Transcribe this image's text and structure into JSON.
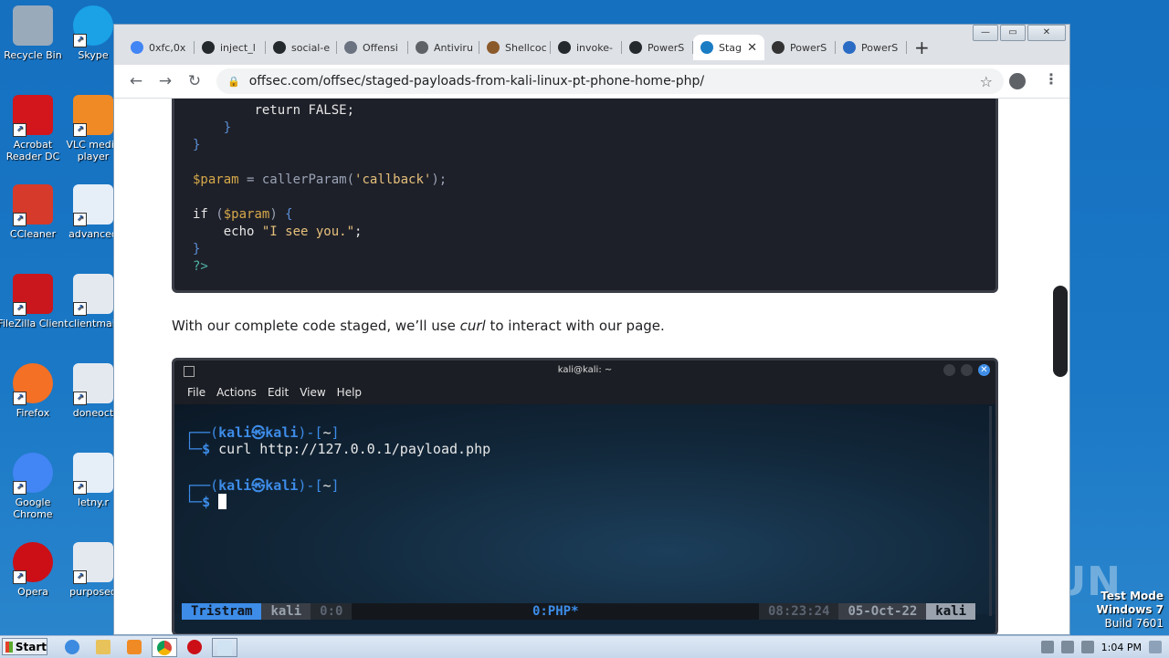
{
  "desktop": {
    "icons": [
      {
        "label": "Recycle Bin",
        "icon": "recycle-bin-icon"
      },
      {
        "label": "Skype",
        "icon": "skype-icon"
      },
      {
        "label": "Acrobat Reader DC",
        "icon": "acrobat-icon"
      },
      {
        "label": "VLC media player",
        "icon": "vlc-icon"
      },
      {
        "label": "CCleaner",
        "icon": "ccleaner-icon"
      },
      {
        "label": "advanced",
        "icon": "word-doc-icon"
      },
      {
        "label": "FileZilla Client",
        "icon": "filezilla-icon"
      },
      {
        "label": "clientmail",
        "icon": "file-icon"
      },
      {
        "label": "Firefox",
        "icon": "firefox-icon"
      },
      {
        "label": "doneoct",
        "icon": "file-icon"
      },
      {
        "label": "Google Chrome",
        "icon": "chrome-icon"
      },
      {
        "label": "letny.r",
        "icon": "word-doc-icon"
      },
      {
        "label": "Opera",
        "icon": "opera-icon"
      },
      {
        "label": "purposed",
        "icon": "file-icon"
      }
    ],
    "watermark": "ANY.RUN",
    "test_mode": {
      "line1": "Test Mode",
      "line2": "Windows 7",
      "line3": "Build 7601"
    }
  },
  "taskbar": {
    "start_label": "Start",
    "clock": "1:04 PM"
  },
  "browser": {
    "tabs": [
      {
        "label": "0xfc,0x",
        "icon": "google-icon",
        "color": "#4285f4"
      },
      {
        "label": "inject_l",
        "icon": "github-icon",
        "color": "#24292e"
      },
      {
        "label": "social-e",
        "icon": "github-icon",
        "color": "#24292e"
      },
      {
        "label": "Offensi",
        "icon": "offensive-icon",
        "color": "#6b7280"
      },
      {
        "label": "Antiviru",
        "icon": "globe-icon",
        "color": "#5f6368"
      },
      {
        "label": "Shellcoc",
        "icon": "shellcode-icon",
        "color": "#8b5a2b"
      },
      {
        "label": "invoke-",
        "icon": "github-icon",
        "color": "#24292e"
      },
      {
        "label": "PowerS",
        "icon": "github-icon",
        "color": "#24292e"
      },
      {
        "label": "Stag",
        "icon": "offsec-icon",
        "color": "#1a7dc4",
        "active": true
      },
      {
        "label": "PowerS",
        "icon": "pt-icon",
        "color": "#333333"
      },
      {
        "label": "PowerS",
        "icon": "powershell-icon",
        "color": "#2a6cc4"
      }
    ],
    "url": "offsec.com/offsec/staged-payloads-from-kali-linux-pt-phone-home-php/"
  },
  "article": {
    "code_lines": [
      {
        "indent": "        ",
        "parts": [
          {
            "t": "return FALSE;",
            "c": "kw"
          }
        ]
      },
      {
        "indent": "    ",
        "parts": [
          {
            "t": "}",
            "c": "br"
          }
        ]
      },
      {
        "indent": "",
        "parts": [
          {
            "t": "}",
            "c": "br"
          }
        ]
      },
      {
        "indent": "",
        "parts": []
      },
      {
        "indent": "",
        "parts": [
          {
            "t": "$param",
            "c": "var"
          },
          {
            "t": " = ",
            "c": "fn"
          },
          {
            "t": "callerParam(",
            "c": "fn"
          },
          {
            "t": "'callback'",
            "c": "str"
          },
          {
            "t": ");",
            "c": "fn"
          }
        ]
      },
      {
        "indent": "",
        "parts": []
      },
      {
        "indent": "",
        "parts": [
          {
            "t": "if ",
            "c": "kw"
          },
          {
            "t": "(",
            "c": "fn"
          },
          {
            "t": "$param",
            "c": "var"
          },
          {
            "t": ") ",
            "c": "fn"
          },
          {
            "t": "{",
            "c": "br"
          }
        ]
      },
      {
        "indent": "    ",
        "parts": [
          {
            "t": "echo ",
            "c": "kw"
          },
          {
            "t": "\"I see you.\"",
            "c": "str"
          },
          {
            "t": ";",
            "c": "kw"
          }
        ]
      },
      {
        "indent": "",
        "parts": [
          {
            "t": "}",
            "c": "br"
          }
        ]
      },
      {
        "indent": "",
        "parts": [
          {
            "t": "?>",
            "c": "ph"
          }
        ]
      }
    ],
    "para_before": "With our complete code staged, we’ll use ",
    "para_em": "curl",
    "para_after": " to interact with our page."
  },
  "terminal": {
    "title": "kali@kali: ~",
    "menu": [
      "File",
      "Actions",
      "Edit",
      "View",
      "Help"
    ],
    "prompt_user": "kali",
    "prompt_at": "㉿",
    "prompt_host": "kali",
    "prompt_dir": "~",
    "command": "curl http://127.0.0.1/payload.php",
    "status": {
      "session": "Tristram",
      "user": "kali",
      "win0": "0:0",
      "win_active": "0:PHP*",
      "time": "08:23:24",
      "date": "05-Oct-22",
      "host": "kali"
    }
  }
}
